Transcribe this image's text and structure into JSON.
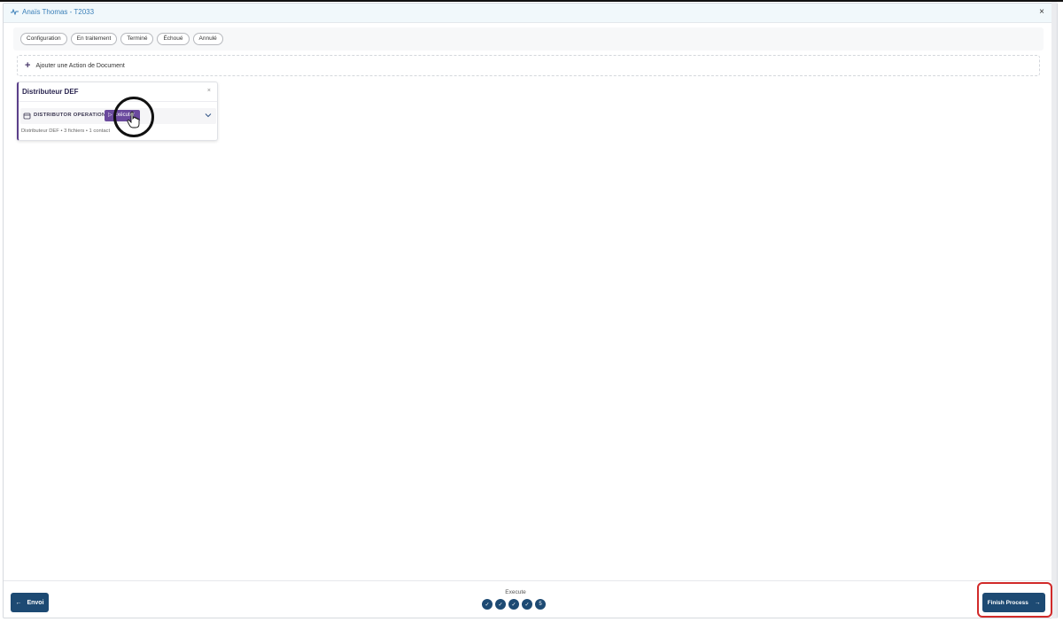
{
  "header": {
    "title": "Anaïs Thomas - T2033",
    "close_icon": "close-icon"
  },
  "tabs": [
    {
      "label": "Configuration"
    },
    {
      "label": "En traitement"
    },
    {
      "label": "Terminé"
    },
    {
      "label": "Échoué"
    },
    {
      "label": "Annulé"
    }
  ],
  "add_action": {
    "label": "Ajouter une Action de Document"
  },
  "card": {
    "title": "Distributeur DEF",
    "close": "×",
    "operation_label": "DISTRIBUTOR OPERATION",
    "run_button": "▷ Exécuter",
    "meta": "Distributeur DEF • 3 fichiers • 1 contact"
  },
  "footer": {
    "back_label": "Envoi",
    "steps_label": "Execute",
    "steps": [
      "✓",
      "✓",
      "✓",
      "✓",
      "5"
    ],
    "finish_label": "Finish Process"
  },
  "colors": {
    "primary": "#1d4a73",
    "accent_purple": "#6b4a9e",
    "highlight_red": "#d12a2a",
    "header_bg": "#f1f8fb"
  }
}
